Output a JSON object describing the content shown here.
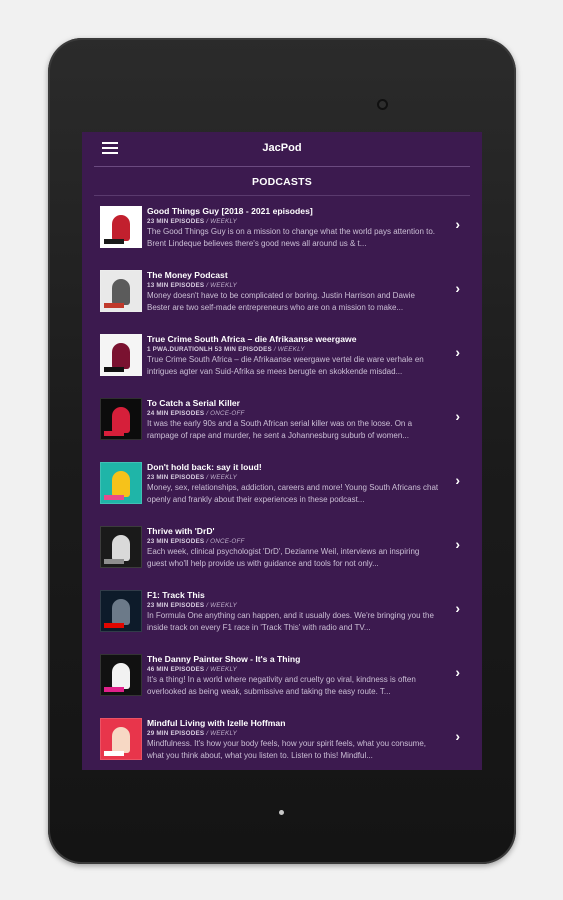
{
  "app": {
    "title": "JacPod"
  },
  "section": {
    "title": "PODCASTS"
  },
  "podcasts": [
    {
      "title": "Good Things Guy [2018 - 2021 episodes]",
      "episodes": "23 MIN EPISODES",
      "frequency": "/ WEEKLY",
      "description": "The Good Things Guy is on a mission to change what the world pays attention to. Brent Lindeque believes there's good news all around us & t...",
      "thumb": {
        "bg": "#ffffff",
        "figure": "#c2202e",
        "tag": "#1a1a1a"
      }
    },
    {
      "title": "The Money Podcast",
      "episodes": "13 MIN EPISODES",
      "frequency": "/ WEEKLY",
      "description": "Money doesn't have to be complicated or boring. Justin Harrison and Dawie Bester are two self-made entrepreneurs who are on a mission to make...",
      "thumb": {
        "bg": "#e9e9e9",
        "figure": "#5b5b5b",
        "tag": "#c0392b"
      }
    },
    {
      "title": "True Crime South Africa – die Afrikaanse weergawe",
      "episodes": "1 PWA.DURATIONLH 53 MIN EPISODES",
      "frequency": "/ WEEKLY",
      "description": "True Crime South Africa – die Afrikaanse weergawe vertel die ware verhale en intrigues agter van Suid-Afrika se mees berugte en skokkende misdad...",
      "thumb": {
        "bg": "#f5f5f5",
        "figure": "#7a1230",
        "tag": "#111111"
      }
    },
    {
      "title": "To Catch a Serial Killer",
      "episodes": "24 MIN EPISODES",
      "frequency": "/ ONCE-OFF",
      "description": "It was the early 90s and a South African serial killer was on the loose. On a rampage of rape and murder, he sent a Johannesburg suburb of women...",
      "thumb": {
        "bg": "#0c0c0c",
        "figure": "#d61f3a",
        "tag": "#d61f3a"
      }
    },
    {
      "title": "Don't hold back: say it loud!",
      "episodes": "23 MIN EPISODES",
      "frequency": "/ WEEKLY",
      "description": "Money, sex, relationships, addiction, careers and more! Young South Africans chat openly and frankly about their experiences in these podcast...",
      "thumb": {
        "bg": "#1fb5a8",
        "figure": "#f6c21a",
        "tag": "#e94b8a"
      }
    },
    {
      "title": "Thrive with 'DrD'",
      "episodes": "23 MIN EPISODES",
      "frequency": "/ ONCE-OFF",
      "description": "Each week, clinical psychologist 'DrD', Dezianne Weil, interviews an inspiring guest who'll help provide us with guidance and tools for not only...",
      "thumb": {
        "bg": "#1a1a1a",
        "figure": "#d9d9d9",
        "tag": "#8e8e8e"
      }
    },
    {
      "title": "F1: Track This",
      "episodes": "23 MIN EPISODES",
      "frequency": "/ WEEKLY",
      "description": "In Formula One anything can happen, and it usually does. We're bringing you the inside track on every F1 race in 'Track This' with radio and TV...",
      "thumb": {
        "bg": "#0d1b2a",
        "figure": "#6c7a89",
        "tag": "#e10600"
      }
    },
    {
      "title": "The Danny Painter Show - It's a Thing",
      "episodes": "46 MIN EPISODES",
      "frequency": "/ WEEKLY",
      "description": "It's a thing! In a world where negativity and cruelty go viral, kindness is often overlooked as being weak, submissive and taking the easy route. T...",
      "thumb": {
        "bg": "#111111",
        "figure": "#f2f2f2",
        "tag": "#e0218a"
      }
    },
    {
      "title": "Mindful Living with Izelle Hoffman",
      "episodes": "29 MIN EPISODES",
      "frequency": "/ WEEKLY",
      "description": "Mindfulness. It's how your body feels, how your spirit feels, what you consume, what you think about, what you listen to. Listen to this! Mindful...",
      "thumb": {
        "bg": "#e8354b",
        "figure": "#f7d8c4",
        "tag": "#ffffff"
      }
    }
  ]
}
